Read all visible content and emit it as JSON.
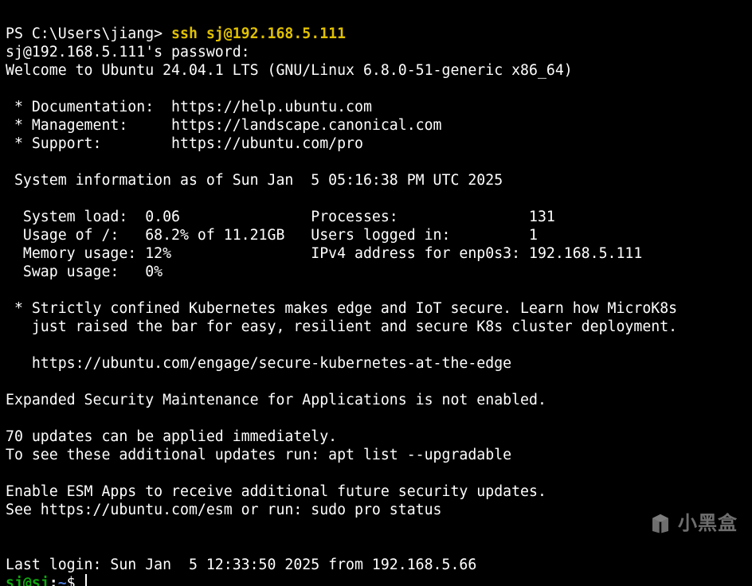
{
  "ps_prompt": "PS C:\\Users\\jiang> ",
  "ssh_command": "ssh sj@192.168.5.111",
  "password_prompt": "sj@192.168.5.111's password:",
  "welcome": "Welcome to Ubuntu 24.04.1 LTS (GNU/Linux 6.8.0-51-generic x86_64)",
  "doc_line": " * Documentation:  https://help.ubuntu.com",
  "mgmt_line": " * Management:     https://landscape.canonical.com",
  "support_line": " * Support:        https://ubuntu.com/pro",
  "sysinfo_header": " System information as of Sun Jan  5 05:16:38 PM UTC 2025",
  "row1": "  System load:  0.06               Processes:               131",
  "row2": "  Usage of /:   68.2% of 11.21GB   Users logged in:         1",
  "row3": "  Memory usage: 12%                IPv4 address for enp0s3: 192.168.5.111",
  "row4": "  Swap usage:   0%",
  "k8s1": " * Strictly confined Kubernetes makes edge and IoT secure. Learn how MicroK8s",
  "k8s2": "   just raised the bar for easy, resilient and secure K8s cluster deployment.",
  "k8s3": "   https://ubuntu.com/engage/secure-kubernetes-at-the-edge",
  "esm_line": "Expanded Security Maintenance for Applications is not enabled.",
  "updates1": "70 updates can be applied immediately.",
  "updates2": "To see these additional updates run: apt list --upgradable",
  "esm_enable1": "Enable ESM Apps to receive additional future security updates.",
  "esm_enable2": "See https://ubuntu.com/esm or run: sudo pro status",
  "last_login": "Last login: Sun Jan  5 12:33:50 2025 from 192.168.5.66",
  "prompt_user": "sj@sj",
  "prompt_sep1": ":",
  "prompt_path": "~",
  "prompt_dollar": "$ ",
  "watermark_text": "小黑盒"
}
